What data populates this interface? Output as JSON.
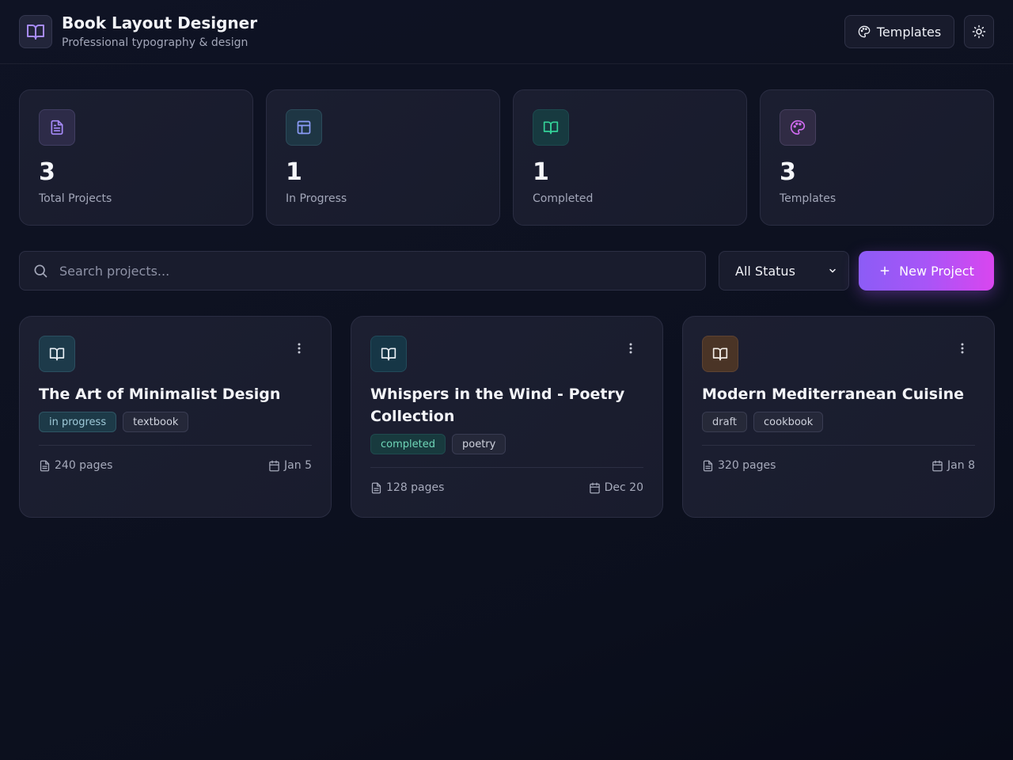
{
  "header": {
    "title": "Book Layout Designer",
    "subtitle": "Professional typography & design",
    "templates_label": "Templates",
    "logo_icon": "book-open-icon",
    "theme_icon": "sun-icon"
  },
  "stats": [
    {
      "value": "3",
      "label": "Total Projects",
      "icon": "file-text-icon",
      "color": "#a78bfa"
    },
    {
      "value": "1",
      "label": "In Progress",
      "icon": "layout-icon",
      "color": "#8b9cf7"
    },
    {
      "value": "1",
      "label": "Completed",
      "icon": "book-open-icon",
      "color": "#34d399"
    },
    {
      "value": "3",
      "label": "Templates",
      "icon": "palette-icon",
      "color": "#d06bf0"
    }
  ],
  "search": {
    "placeholder": "Search projects..."
  },
  "filter": {
    "selected": "All Status"
  },
  "new_project": {
    "label": "New Project"
  },
  "projects": [
    {
      "title": "The Art of Minimalist Design",
      "status": "in progress",
      "type": "textbook",
      "pages": "240 pages",
      "date": "Jan 5",
      "icon_bg": "#1d3a4a"
    },
    {
      "title": "Whispers in the Wind - Poetry Collection",
      "status": "completed",
      "type": "poetry",
      "pages": "128 pages",
      "date": "Dec 20",
      "icon_bg": "#163646"
    },
    {
      "title": "Modern Mediterranean Cuisine",
      "status": "draft",
      "type": "cookbook",
      "pages": "320 pages",
      "date": "Jan 8",
      "icon_bg": "#4a3426"
    }
  ],
  "colors": {
    "accent": "#a855f7",
    "accent_end": "#d946ef",
    "background": "#0d1120",
    "card": "#1b1e30"
  }
}
